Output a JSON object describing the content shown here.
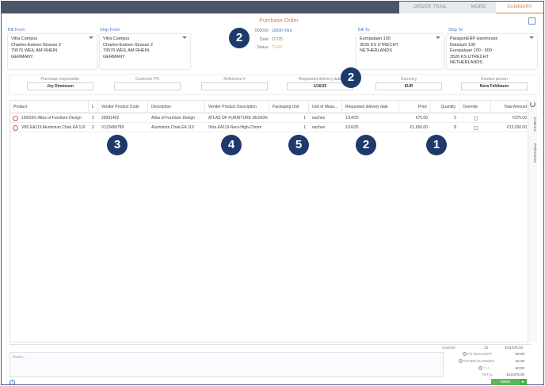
{
  "tabs": [
    "ORDER TRAIL",
    "MORE",
    "SUMMARY"
  ],
  "title": "Purchase Order",
  "bill_from": {
    "label": "Bill From",
    "lines": [
      "Vitra Campus",
      "Charles-Eames-Strasse 2",
      "79576 WEIL AM RHEIN",
      "GERMANY"
    ]
  },
  "ship_from": {
    "label": "Ship From",
    "lines": [
      "Vitra Campus",
      "Charles-Eames-Strasse 2",
      "79576 WEIL AM RHEIN",
      "GERMANY"
    ]
  },
  "bill_to": {
    "label": "Bill To",
    "lines": [
      "Europalaan 100",
      "3526 KS  UTRECHT",
      "NETHERLANDS"
    ]
  },
  "ship_to": {
    "label": "Ship To",
    "lines": [
      "ParagonERP warehouse",
      "Dotslash 100",
      "Europalaan 100 - 500",
      "3526 KS  UTRECHT",
      "NETHERLANDS"
    ]
  },
  "meta": {
    "number": "000000:",
    "vendor": "10000 Vitra",
    "date_label": "Date:",
    "date": "1/7/25",
    "status_label": "Status:",
    "status": "TEMP"
  },
  "fields": [
    {
      "label": "Purchase responsible",
      "value": "Joy Dinnissen"
    },
    {
      "label": "Customer PO",
      "value": ""
    },
    {
      "label": "Reference #",
      "value": ""
    },
    {
      "label": "Requested delivery date",
      "value": "1/16/25"
    },
    {
      "label": "Currency",
      "value": "EUR"
    },
    {
      "label": "Contact person",
      "value": "Nora Fehlbaum"
    }
  ],
  "badges": [
    "2",
    "2",
    "3",
    "4",
    "5",
    "2",
    "1"
  ],
  "columns": [
    "Product",
    "L",
    "Vendor Product Code",
    "Description",
    "Vendor Product Description",
    "Packaging Unit",
    "Unit of Meas...",
    "Requested delivery date",
    "Price",
    "Quantity",
    "Override",
    "Total Amount"
  ],
  "rows": [
    {
      "product": "1000001 Atlas of Furniture Design",
      "line": "1",
      "vcode": "20081402",
      "desc": "Atlas of Furniture Design",
      "vdesc": "ATLAS OF FURNITURE DESIGN",
      "pack": "1",
      "uom": "eaches",
      "rdd": "1/14/25",
      "price": "€75.00",
      "qty": "5",
      "total": "€375.00"
    },
    {
      "product": "VB0 EA119 Aluminium Chair EA 119",
      "line": "2",
      "vcode": "V123456789",
      "desc": "Aluminium Chair EA 119",
      "vdesc": "Vitra EA119-Nero-High-Chrom",
      "pack": "1",
      "uom": "eaches",
      "rdd": "1/16/25",
      "price": "€1,650.00",
      "qty": "8",
      "total": "€13,200.00"
    }
  ],
  "side": {
    "columns": "Columns",
    "preferences": "Preferences"
  },
  "totals": {
    "subtotal_label": "Subtotal",
    "subtotal_qty": "13",
    "subtotal": "€13,575.00",
    "po_discount_label": "PO DISCOUNT",
    "po_discount": "€0.00",
    "other_label": "OTHER CHARGES",
    "other": "€0.00",
    "tax_label": "TAX",
    "tax": "€0.00",
    "total_label": "TOTAL",
    "total": "€13,575.00"
  },
  "notes_placeholder": "Notes...",
  "issue_label": "Issue",
  "help": "i"
}
